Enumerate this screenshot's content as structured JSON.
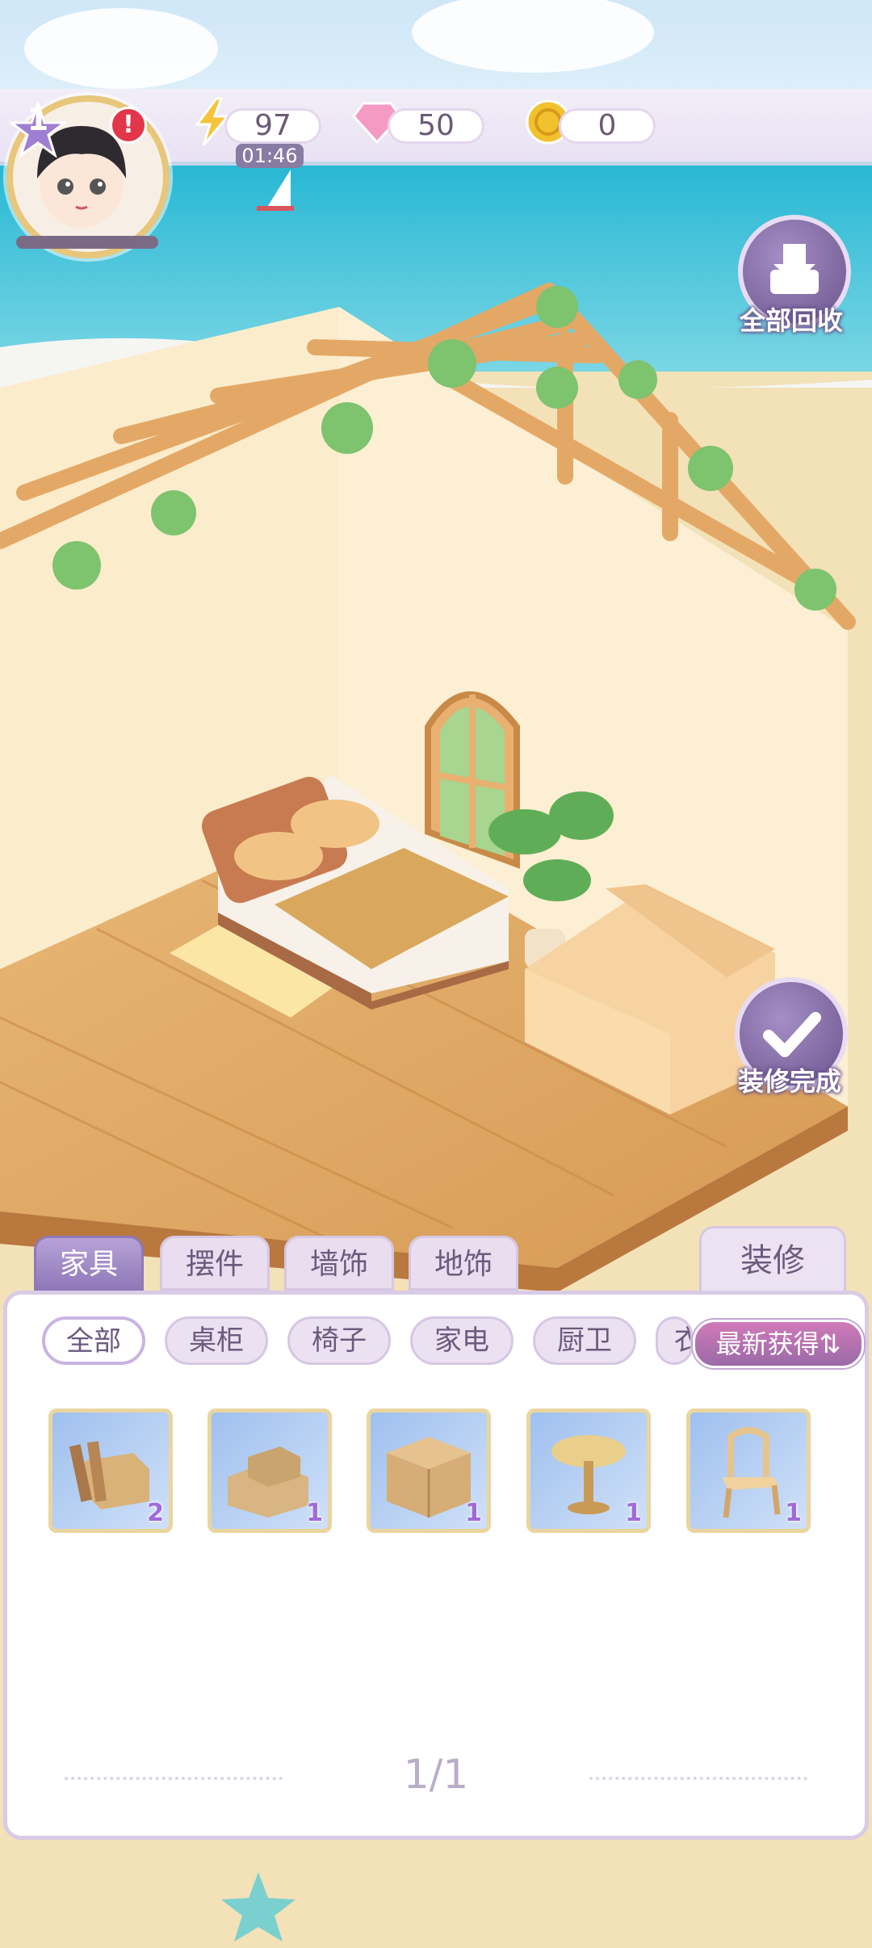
{
  "player": {
    "level": "1",
    "alert": "!"
  },
  "resources": {
    "energy": "97",
    "energy_timer": "01:46",
    "gems": "50",
    "coins": "0"
  },
  "side_buttons": {
    "recycle_all": "全部回收",
    "decorate_done": "装修完成"
  },
  "tabs": [
    "家具",
    "摆件",
    "墙饰",
    "地饰"
  ],
  "renovate_tab": "装修",
  "filters": [
    "全部",
    "桌柜",
    "椅子",
    "家电",
    "厨卫",
    "衣"
  ],
  "sort_button": "最新获得⇅",
  "items": [
    {
      "name": "wood-planks-box",
      "count": "2"
    },
    {
      "name": "cardboard-boxes",
      "count": "1"
    },
    {
      "name": "cardboard-box",
      "count": "1"
    },
    {
      "name": "round-table",
      "count": "1"
    },
    {
      "name": "wooden-chair",
      "count": "1"
    }
  ],
  "pagination": "1/1",
  "colors": {
    "accent": "#8f79b8",
    "panel_border": "#d9cbe6",
    "count": "#a06ad8"
  }
}
